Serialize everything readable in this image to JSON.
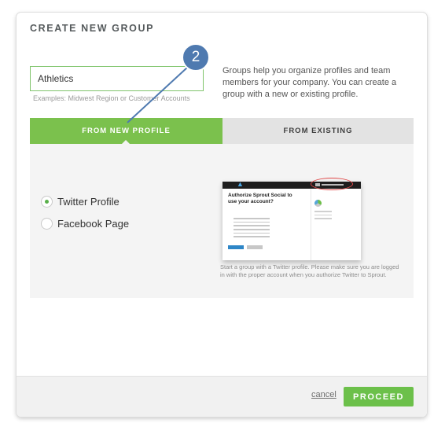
{
  "dialog": {
    "title": "CREATE NEW GROUP",
    "name_input": {
      "value": "Athletics",
      "placeholder": ""
    },
    "examples": "Examples: Midwest Region or Customer Accounts",
    "help_text": "Groups help you organize profiles and team members for your company. You can create a group with a new or existing profile."
  },
  "tabs": [
    {
      "label": "FROM NEW PROFILE",
      "active": true
    },
    {
      "label": "FROM EXISTING",
      "active": false
    }
  ],
  "profile_types": [
    {
      "label": "Twitter Profile",
      "selected": true
    },
    {
      "label": "Facebook Page",
      "selected": false
    }
  ],
  "preview": {
    "heading": "Authorize Sprout Social to use your account?",
    "caption": "Start a group with a Twitter profile. Please make sure you are logged in with the proper account when you authorize Twitter to Sprout.",
    "bird_icon": "twitter-bird-icon"
  },
  "footer": {
    "cancel_label": "cancel",
    "proceed_label": "PROCEED"
  },
  "annotation": {
    "step_number": "2"
  },
  "colors": {
    "accent_green": "#7bc14d",
    "badge_blue": "#4f7ab0",
    "tab_inactive": "#e3e3e3",
    "panel_bg": "#f4f4f4"
  }
}
